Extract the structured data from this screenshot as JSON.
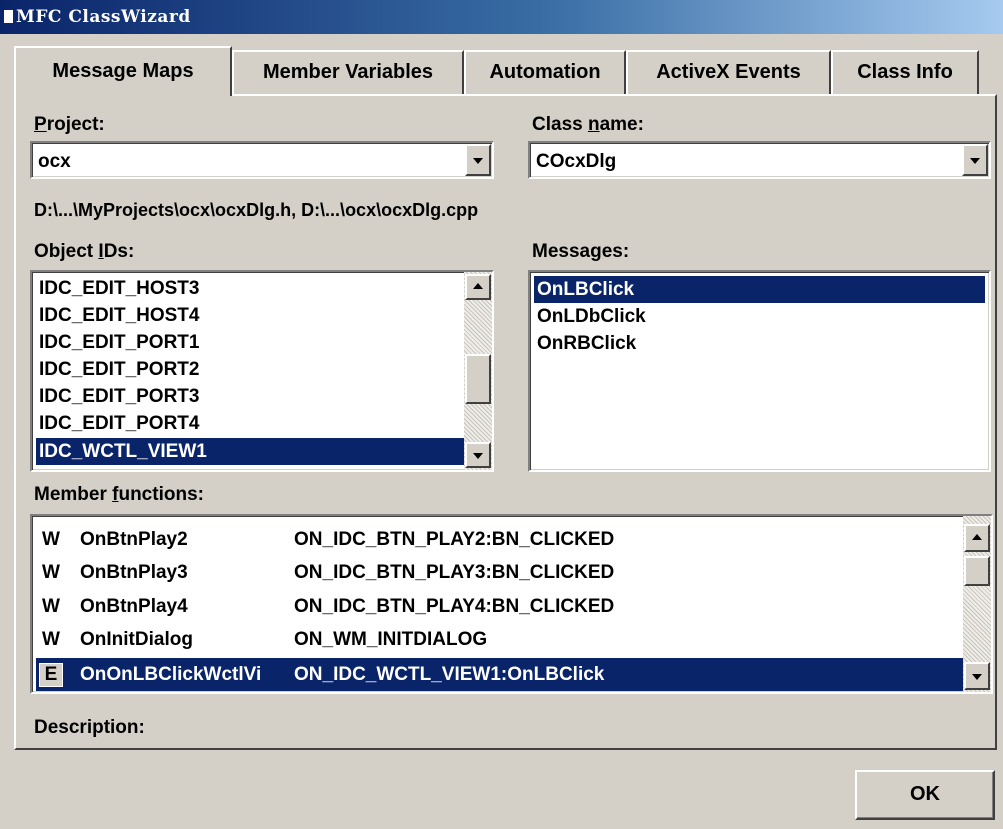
{
  "window": {
    "title": "MFC ClassWizard"
  },
  "tabs": [
    {
      "label": "Message Maps",
      "active": true
    },
    {
      "label": "Member Variables",
      "active": false
    },
    {
      "label": "Automation",
      "active": false
    },
    {
      "label": "ActiveX Events",
      "active": false
    },
    {
      "label": "Class Info",
      "active": false
    }
  ],
  "project": {
    "label_underlined": "P",
    "label_rest": "roject:",
    "value": "ocx"
  },
  "class_name": {
    "label_pre": "Class ",
    "label_underlined": "n",
    "label_post": "ame:",
    "value": "COcxDlg"
  },
  "file_path": "D:\\...\\MyProjects\\ocx\\ocxDlg.h, D:\\...\\ocx\\ocxDlg.cpp",
  "object_ids": {
    "label_pre": "Object ",
    "label_underlined": "I",
    "label_post": "Ds:",
    "items": [
      "IDC_EDIT_HOST3",
      "IDC_EDIT_HOST4",
      "IDC_EDIT_PORT1",
      "IDC_EDIT_PORT2",
      "IDC_EDIT_PORT3",
      "IDC_EDIT_PORT4",
      "IDC_WCTL_VIEW1"
    ],
    "selected_index": 6
  },
  "messages": {
    "label_pre": "Messa",
    "label_underlined": "g",
    "label_post": "es:",
    "items": [
      "OnLBClick",
      "OnLDbClick",
      "OnRBClick"
    ],
    "selected_index": 0
  },
  "member_functions": {
    "label_pre": "Member ",
    "label_underlined": "f",
    "label_post": "unctions:",
    "rows": [
      {
        "badge": "W",
        "function": "OnBtnPlay2",
        "handler": "ON_IDC_BTN_PLAY2:BN_CLICKED"
      },
      {
        "badge": "W",
        "function": "OnBtnPlay3",
        "handler": "ON_IDC_BTN_PLAY3:BN_CLICKED"
      },
      {
        "badge": "W",
        "function": "OnBtnPlay4",
        "handler": "ON_IDC_BTN_PLAY4:BN_CLICKED"
      },
      {
        "badge": "W",
        "function": "OnInitDialog",
        "handler": "ON_WM_INITDIALOG"
      },
      {
        "badge": "E",
        "function": "OnOnLBClickWctlVi",
        "handler": "ON_IDC_WCTL_VIEW1:OnLBClick"
      }
    ],
    "selected_index": 4
  },
  "description": {
    "label": "Description:"
  },
  "buttons": {
    "ok": "OK"
  },
  "colors": {
    "selection": "#0a246a",
    "face": "#d4d0c8",
    "title_start": "#0a246a",
    "title_end": "#a6caf0"
  }
}
